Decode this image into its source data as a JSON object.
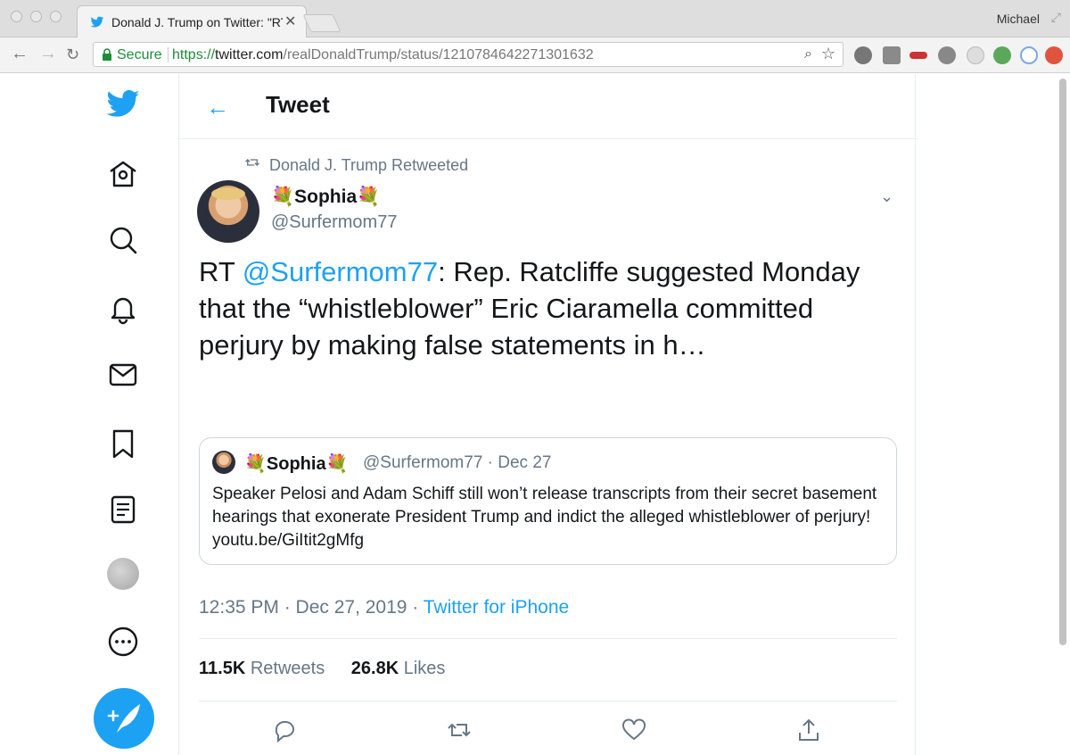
{
  "browser": {
    "tab_title": "Donald J. Trump on Twitter: \"RT",
    "profile_name": "Michael",
    "secure_label": "Secure",
    "url_scheme": "https://",
    "url_host": "twitter.com",
    "url_path": "/realDonaldTrump/status/1210784642271301632"
  },
  "header": {
    "title": "Tweet"
  },
  "retweet": {
    "label": "Donald J. Trump Retweeted"
  },
  "author": {
    "display_name": "💐Sophia💐",
    "handle": "@Surfermom77"
  },
  "tweet": {
    "prefix": "RT ",
    "mention": "@Surfermom77",
    "body": ": Rep. Ratcliffe suggested Monday that the “whistleblower” Eric Ciaramella committed perjury by making false statements in h…"
  },
  "quoted_tweet": {
    "display_name": "💐Sophia💐",
    "handle_date": "@Surfermom77 · Dec 27",
    "body": "Speaker Pelosi and Adam Schiff still won’t release transcripts from their secret basement hearings that exonerate President Trump and indict the alleged whistleblower of perjury! youtu.be/GiItit2gMfg"
  },
  "meta": {
    "time_date": "12:35 PM · Dec 27, 2019 · ",
    "source": "Twitter for iPhone"
  },
  "stats": {
    "retweets_count": "11.5K",
    "retweets_label": " Retweets",
    "likes_count": "26.8K",
    "likes_label": " Likes"
  },
  "icons": {
    "sidebar": [
      "twitter-bird-icon",
      "home-icon",
      "explore-icon",
      "notifications-icon",
      "messages-icon",
      "bookmarks-icon",
      "lists-icon",
      "profile-avatar",
      "more-icon"
    ],
    "actions": [
      "reply-icon",
      "retweet-icon",
      "like-icon",
      "share-icon"
    ]
  },
  "colors": {
    "accent": "#1da1f2",
    "secondary_text": "#657786",
    "border": "#e6ecf0",
    "secure_green": "#1e8c3a"
  }
}
